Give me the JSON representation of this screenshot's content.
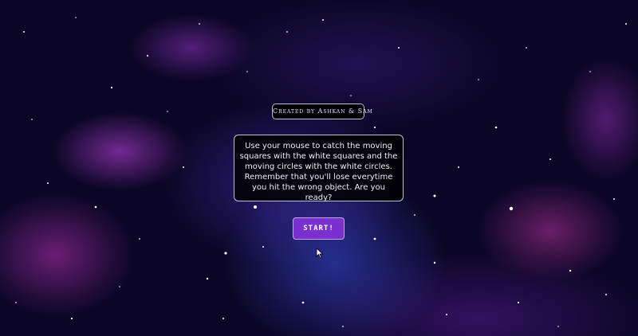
{
  "credit": {
    "text": "Created by Ashkan & Sam"
  },
  "instructions": {
    "text": "Use your mouse to catch the moving squares with the white squares and the moving circles with the white circles. Remember that you'll lose everytime you hit the wrong object. Are you ready?"
  },
  "start_button": {
    "label": "START!"
  },
  "colors": {
    "button": "#7a2fd0",
    "panel": "#000000",
    "border": "#bfbfcf",
    "background": "#0b0626"
  },
  "icons": {
    "cursor": "mouse-pointer-icon"
  }
}
